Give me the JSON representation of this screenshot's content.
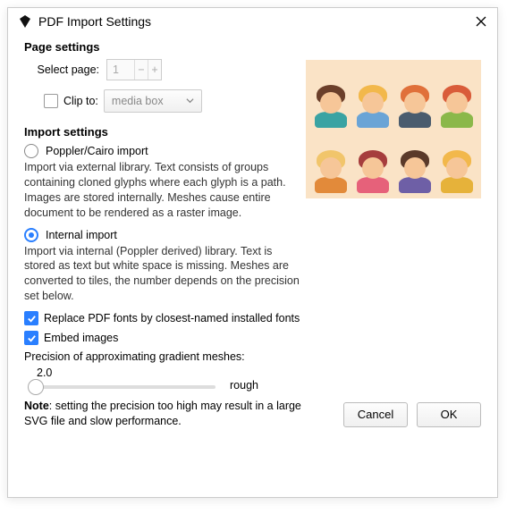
{
  "window": {
    "title": "PDF Import Settings"
  },
  "page_settings": {
    "heading": "Page settings",
    "select_page_label": "Select page:",
    "select_page_value": "1",
    "clip_to_label": "Clip to:",
    "clip_to_checked": false,
    "clip_to_combo": "media box"
  },
  "import_settings": {
    "heading": "Import settings",
    "poppler_label": "Poppler/Cairo import",
    "poppler_selected": false,
    "poppler_desc": "Import via external library. Text consists of groups containing cloned glyphs where each glyph is a path. Images are stored internally. Meshes cause entire document to be rendered as a raster image.",
    "internal_label": "Internal import",
    "internal_selected": true,
    "internal_desc": "Import via internal (Poppler derived) library. Text is stored as text but white space is missing. Meshes are converted to tiles, the number depends on the precision set below.",
    "replace_fonts_label": "Replace PDF fonts by closest-named installed fonts",
    "replace_fonts_checked": true,
    "embed_images_label": "Embed images",
    "embed_images_checked": true,
    "precision_label": "Precision of approximating gradient meshes:",
    "precision_value": "2.0",
    "precision_hint": "rough",
    "note_strong": "Note",
    "note_text": ": setting the precision too high may result in a large SVG file and slow performance."
  },
  "buttons": {
    "cancel": "Cancel",
    "ok": "OK"
  },
  "preview_avatars": [
    {
      "hair": "#6b3f2a",
      "body": "#3aa3a3"
    },
    {
      "hair": "#f2b84b",
      "body": "#6aa4d6"
    },
    {
      "hair": "#e0703a",
      "body": "#4a5c6e"
    },
    {
      "hair": "#d95c3a",
      "body": "#8bb84a"
    },
    {
      "hair": "#f1c56b",
      "body": "#e28a3a"
    },
    {
      "hair": "#a63d3d",
      "body": "#e6617a"
    },
    {
      "hair": "#5a3a2a",
      "body": "#6e5fa6"
    },
    {
      "hair": "#f2b84b",
      "body": "#e6b23a"
    }
  ]
}
